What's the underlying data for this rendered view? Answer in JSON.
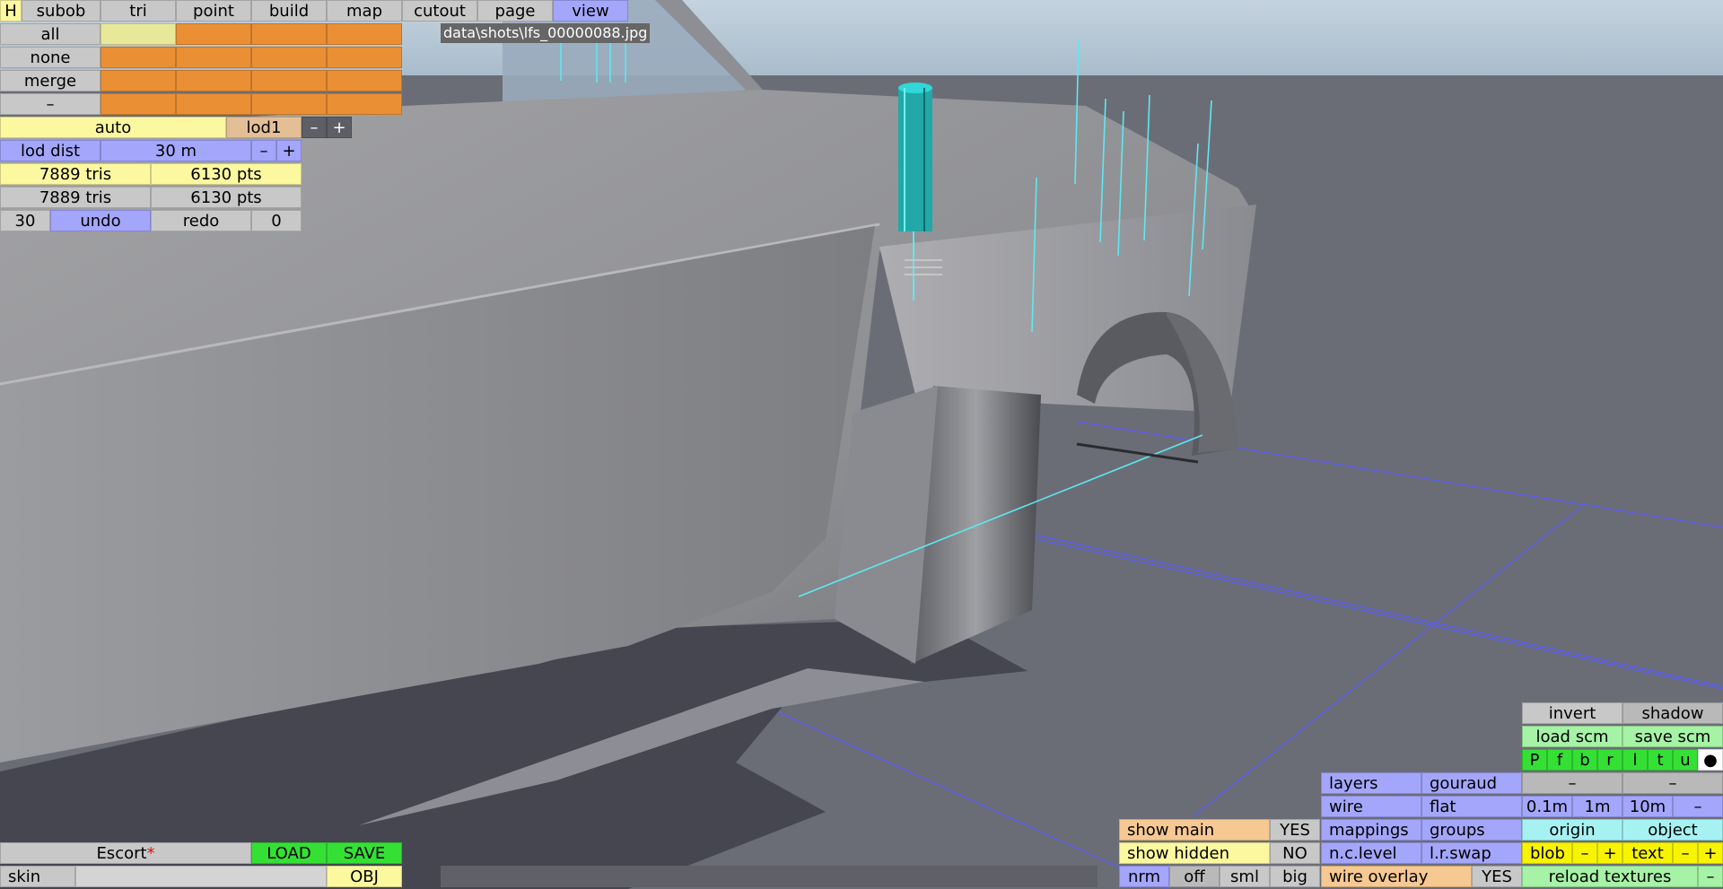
{
  "tabs": [
    "H",
    "subob",
    "tri",
    "point",
    "build",
    "map",
    "cutout",
    "page",
    "view"
  ],
  "active_tab": "view",
  "filename": "data\\shots\\lfs_00000088.jpg",
  "select_rows": [
    "all",
    "none",
    "merge",
    "–"
  ],
  "lod": {
    "mode": "auto",
    "level": "lod1",
    "minus": "–",
    "plus": "+",
    "dist_label": "lod dist",
    "dist_value": "30 m"
  },
  "stats": [
    {
      "tris": "7889 tris",
      "pts": "6130 pts"
    },
    {
      "tris": "7889 tris",
      "pts": "6130 pts"
    }
  ],
  "history": {
    "count": "30",
    "undo": "undo",
    "redo": "redo",
    "redo_count": "0"
  },
  "model": {
    "name": "Escort",
    "modified_mark": "*",
    "load": "LOAD",
    "save": "SAVE",
    "skin": "skin",
    "obj": "OBJ"
  },
  "right_panel": {
    "invert": "invert",
    "shadow": "shadow",
    "load_scm": "load scm",
    "save_scm": "save scm",
    "views": [
      "P",
      "f",
      "b",
      "r",
      "l",
      "t",
      "u",
      "●"
    ],
    "layers": "layers",
    "gouraud": "gouraud",
    "dash1": "–",
    "dash2": "–",
    "wire": "wire",
    "flat": "flat",
    "grid_sizes": [
      "0.1m",
      "1m",
      "10m"
    ],
    "grid_minus": "–",
    "mappings": "mappings",
    "groups": "groups",
    "origin": "origin",
    "object": "object",
    "nc_level": "n.c.level",
    "lr_swap": "l.r.swap",
    "blob": "blob",
    "text": "text",
    "minus": "–",
    "plus": "+",
    "nrm": "nrm",
    "off": "off",
    "sml": "sml",
    "big": "big",
    "wire_overlay": "wire overlay",
    "wire_overlay_value": "YES",
    "reload_textures": "reload textures",
    "reload_minus": "–"
  },
  "show": {
    "main_label": "show main",
    "main_value": "YES",
    "hidden_label": "show hidden",
    "hidden_value": "NO"
  },
  "colors": {
    "viewport_bg": "#6b6d76",
    "sky": "#b8cad8",
    "body_panel": "#9c9c9e",
    "guide_lines": "#5ee8f0",
    "grid_lines": "#5a5cf0"
  }
}
